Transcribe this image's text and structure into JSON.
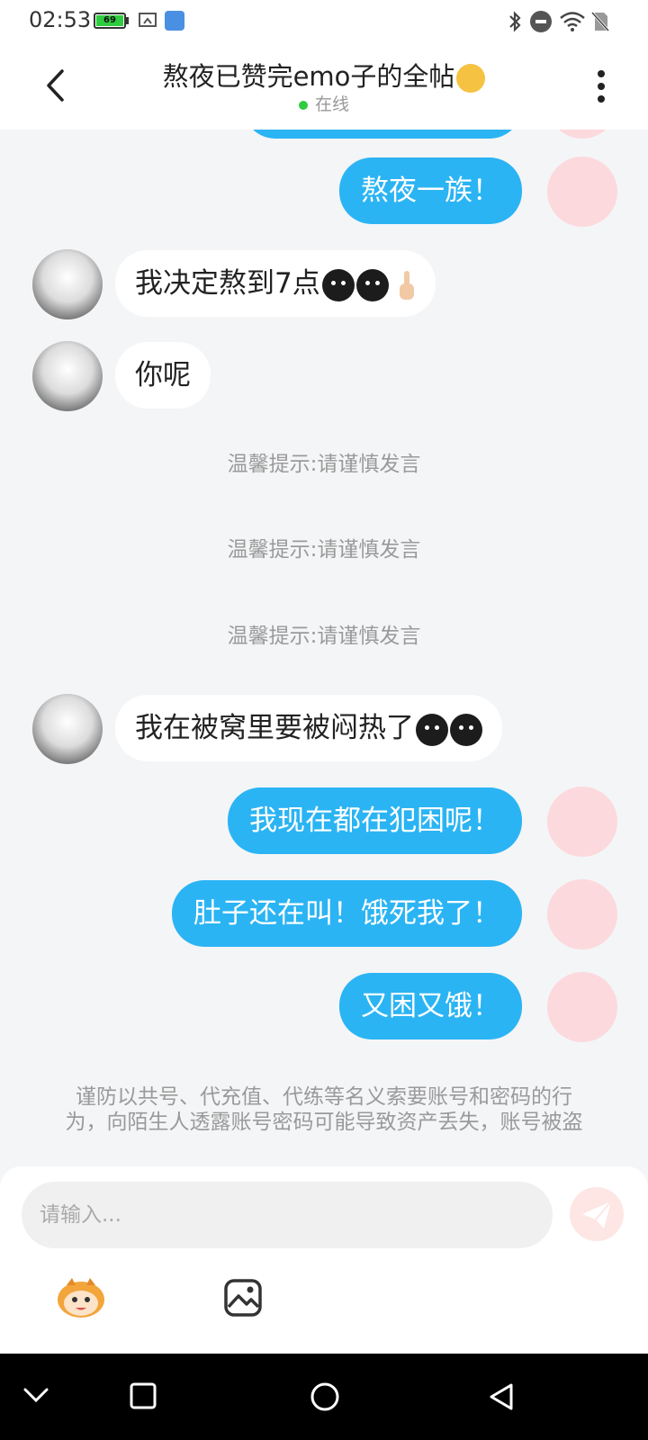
{
  "status_bar": {
    "time": "02:53",
    "battery_level": "69",
    "icons": [
      "screenshot-icon",
      "app-icon",
      "bluetooth-icon",
      "do-not-disturb-icon",
      "wifi-icon",
      "no-sim-icon"
    ]
  },
  "header": {
    "title": "熬夜已赞完emo子的全帖",
    "title_emoji": "smiling-face-icon",
    "status": "在线",
    "status_color": "#2ecc40"
  },
  "messages": [
    {
      "side": "right",
      "text": "熬夜一族！"
    },
    {
      "side": "left",
      "text": "我决定熬到7点",
      "emojis": [
        "black-face-emoji",
        "black-face-emoji",
        "finger-emoji"
      ]
    },
    {
      "side": "left",
      "text": "你呢"
    },
    {
      "side": "system",
      "text": "温馨提示:请谨慎发言"
    },
    {
      "side": "system",
      "text": "温馨提示:请谨慎发言"
    },
    {
      "side": "system",
      "text": "温馨提示:请谨慎发言"
    },
    {
      "side": "left",
      "text": "我在被窝里要被闷热了",
      "emojis": [
        "black-face-emoji",
        "black-face-emoji"
      ]
    },
    {
      "side": "right",
      "text": "我现在都在犯困呢！"
    },
    {
      "side": "right",
      "text": "肚子还在叫！饿死我了！"
    },
    {
      "side": "right",
      "text": "又困又饿！"
    }
  ],
  "warning": {
    "line1": "谨防以共号、代充值、代练等名义索要账号和密码的行",
    "line2": "为，向陌生人透露账号密码可能导致资产丢失，账号被盗"
  },
  "input": {
    "placeholder": "请输入..."
  },
  "colors": {
    "accent": "#2bb4f3",
    "background": "#f4f5f7",
    "send_button": "#fde6e3"
  }
}
